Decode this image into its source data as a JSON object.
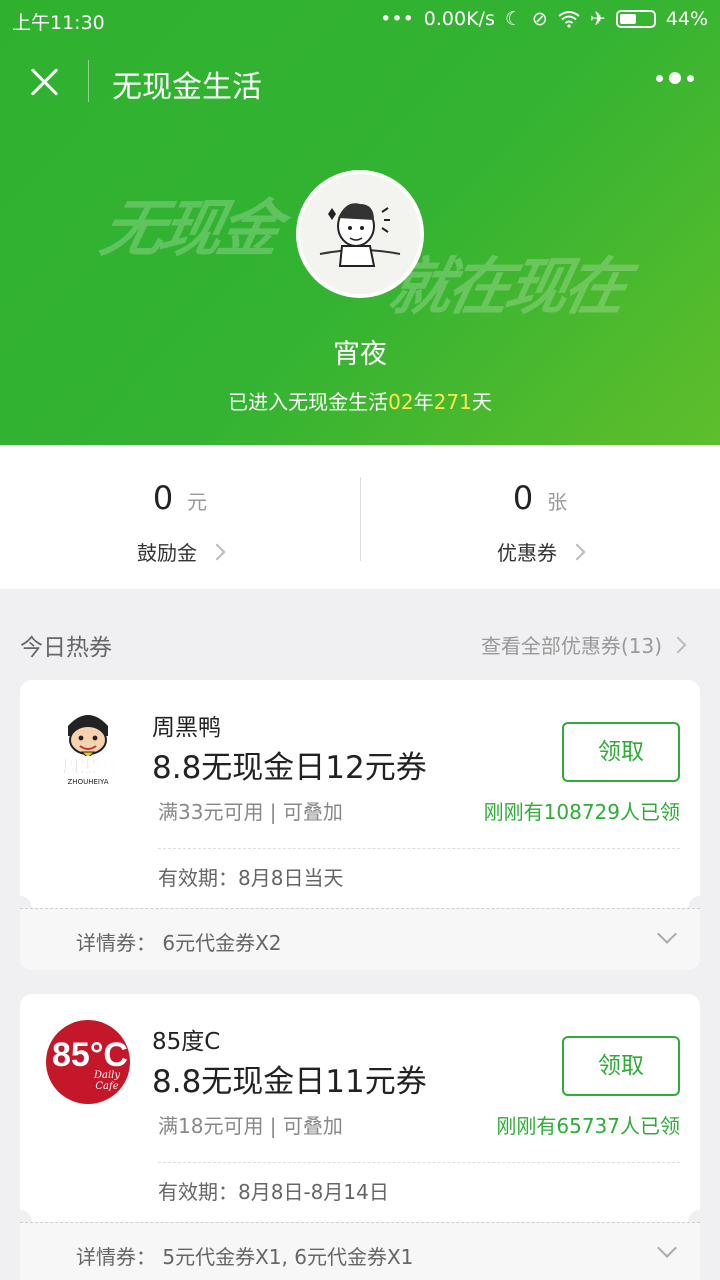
{
  "status": {
    "time": "上午11:30",
    "network": "0.00K/s",
    "battery": "44%"
  },
  "nav": {
    "title": "无现金生活"
  },
  "hero": {
    "calligraphy_left": "无现金",
    "calligraphy_right": "就在现在",
    "username": "宵夜",
    "days_prefix": "已进入无现金生活",
    "years": "02",
    "years_unit": "年",
    "days": "271",
    "days_unit": "天"
  },
  "stats": {
    "reward": {
      "value": "0",
      "unit": "元",
      "label": "鼓励金"
    },
    "coupons": {
      "value": "0",
      "unit": "张",
      "label": "优惠券"
    }
  },
  "section": {
    "title": "今日热券",
    "view_all": "查看全部优惠券(13)"
  },
  "cards": [
    {
      "brand": "周黑鸭",
      "title": "8.8无现金日12元券",
      "condition": "满33元可用 | 可叠加",
      "button": "领取",
      "claimed": "刚刚有108729人已领",
      "validity": "有效期：8月8日当天",
      "detail": "详情券：  6元代金券X2"
    },
    {
      "brand": "85度C",
      "title": "8.8无现金日11元券",
      "condition": "满18元可用 | 可叠加",
      "button": "领取",
      "claimed": "刚刚有65737人已领",
      "validity": "有效期：8月8日-8月14日",
      "detail": "详情券：  5元代金券X1, 6元代金券X1",
      "logo_big": "85°C",
      "logo_small": "Daily Cafe"
    }
  ],
  "colors": {
    "green": "#34b332",
    "accent_green": "#2eac35",
    "highlight": "#ffe94a",
    "logo_red": "#c4182a"
  }
}
